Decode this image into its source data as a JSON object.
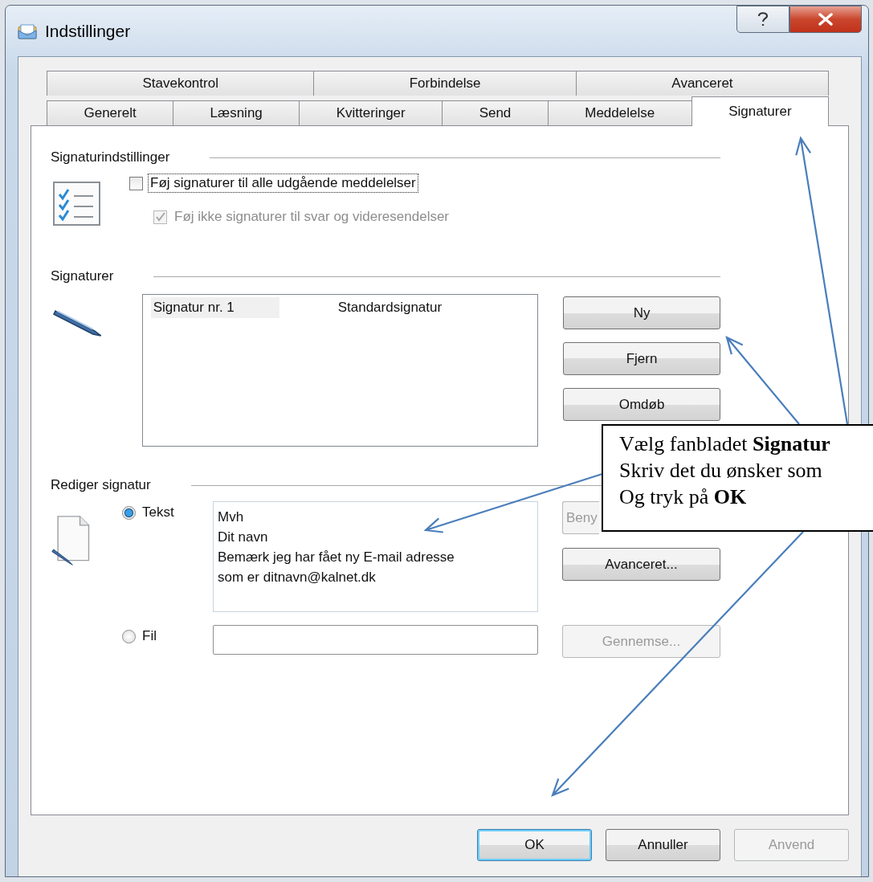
{
  "window": {
    "title": "Indstillinger"
  },
  "tab_rows": [
    {
      "tabs": [
        {
          "label": "Stavekontrol",
          "selected": false
        },
        {
          "label": "Forbindelse",
          "selected": false
        },
        {
          "label": "Avanceret",
          "selected": false
        }
      ]
    },
    {
      "tabs": [
        {
          "label": "Generelt",
          "selected": false
        },
        {
          "label": "Læsning",
          "selected": false
        },
        {
          "label": "Kvitteringer",
          "selected": false
        },
        {
          "label": "Send",
          "selected": false
        },
        {
          "label": "Meddelelse",
          "selected": false
        },
        {
          "label": "Signaturer",
          "selected": true
        }
      ]
    }
  ],
  "signature_settings": {
    "heading": "Signaturindstillinger",
    "options": [
      {
        "label": "Føj signaturer til alle udgående meddelelser",
        "checked": false,
        "disabled": false,
        "focused": true
      },
      {
        "label": "Føj ikke signaturer til svar og videresendelser",
        "checked": true,
        "disabled": true,
        "focused": false
      }
    ]
  },
  "signatures": {
    "heading": "Signaturer",
    "list": [
      {
        "name": "Signatur nr. 1",
        "type": "Standardsignatur",
        "selected": true
      }
    ],
    "buttons": [
      {
        "label": "Ny",
        "disabled": false
      },
      {
        "label": "Fjern",
        "disabled": false
      },
      {
        "label": "Omdøb",
        "disabled": false
      }
    ]
  },
  "edit_signature": {
    "heading": "Rediger signatur",
    "sources": [
      {
        "kind": "text",
        "label": "Tekst",
        "selected": true,
        "value": "Mvh\nDit navn\nBemærk jeg har fået ny E-mail adresse\nsom er ditnavn@kalnet.dk",
        "buttons": [
          {
            "label": "Beny",
            "disabled": true,
            "cut_off": true
          },
          {
            "label": "Avanceret...",
            "disabled": false
          }
        ]
      },
      {
        "kind": "file",
        "label": "Fil",
        "selected": false,
        "buttons": [
          {
            "label": "Gennemse...",
            "disabled": true
          }
        ]
      }
    ]
  },
  "footer_buttons": [
    {
      "label": "OK",
      "default": true,
      "disabled": false
    },
    {
      "label": "Annuller",
      "default": false,
      "disabled": false
    },
    {
      "label": "Anvend",
      "default": false,
      "disabled": true
    }
  ],
  "callout": {
    "lines": [
      "Vælg fanbladet **Signatur**",
      "Skriv det du ønsker som",
      "Og tryk på **OK**"
    ]
  }
}
